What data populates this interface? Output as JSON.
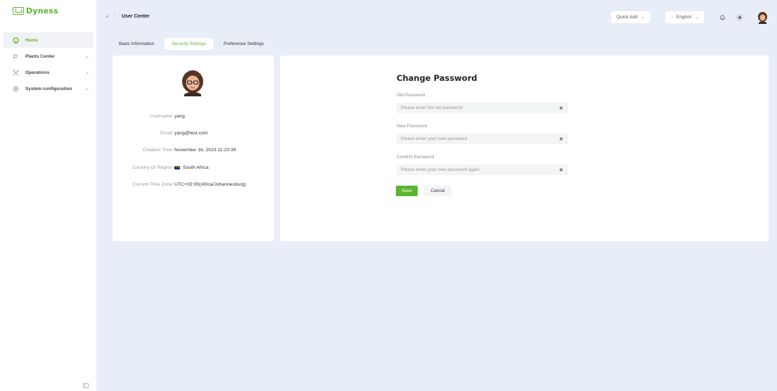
{
  "brand": {
    "name": "Dyness",
    "color": "#5cb531"
  },
  "sidebar": {
    "items": [
      {
        "label": "Home",
        "icon": "home-icon",
        "active": true
      },
      {
        "label": "Plants Center",
        "icon": "plant-icon",
        "expandable": true
      },
      {
        "label": "Operations",
        "icon": "tools-icon",
        "expandable": true
      },
      {
        "label": "System configuration",
        "icon": "gear-icon",
        "expandable": true
      }
    ]
  },
  "header": {
    "breadcrumb_title": "User Center",
    "quick_add_label": "Quick Add",
    "language_label": "English"
  },
  "tabs": [
    {
      "label": "Basic Information",
      "active": false
    },
    {
      "label": "Security Settings",
      "active": true
    },
    {
      "label": "Preference Settings",
      "active": false
    }
  ],
  "profile": {
    "rows": [
      {
        "label": "Username",
        "value": "yang"
      },
      {
        "label": "Email",
        "value": "yang@test.com"
      },
      {
        "label": "Creation Time",
        "value": "November 16, 2023 11:23:39"
      },
      {
        "label": "Country Or Region",
        "value": "South Africa"
      },
      {
        "label": "Current Time Zone",
        "value": "UTC+02:00(Africa/Johannesburg)"
      }
    ]
  },
  "change_password": {
    "title": "Change Password",
    "old_label": "Old Password",
    "old_placeholder": "Please enter the old password",
    "new_label": "New Password",
    "new_placeholder": "Please enter your new password",
    "confirm_label": "Confirm Password",
    "confirm_placeholder": "Please enter your new password again",
    "save_label": "Save",
    "cancel_label": "Cancel"
  }
}
